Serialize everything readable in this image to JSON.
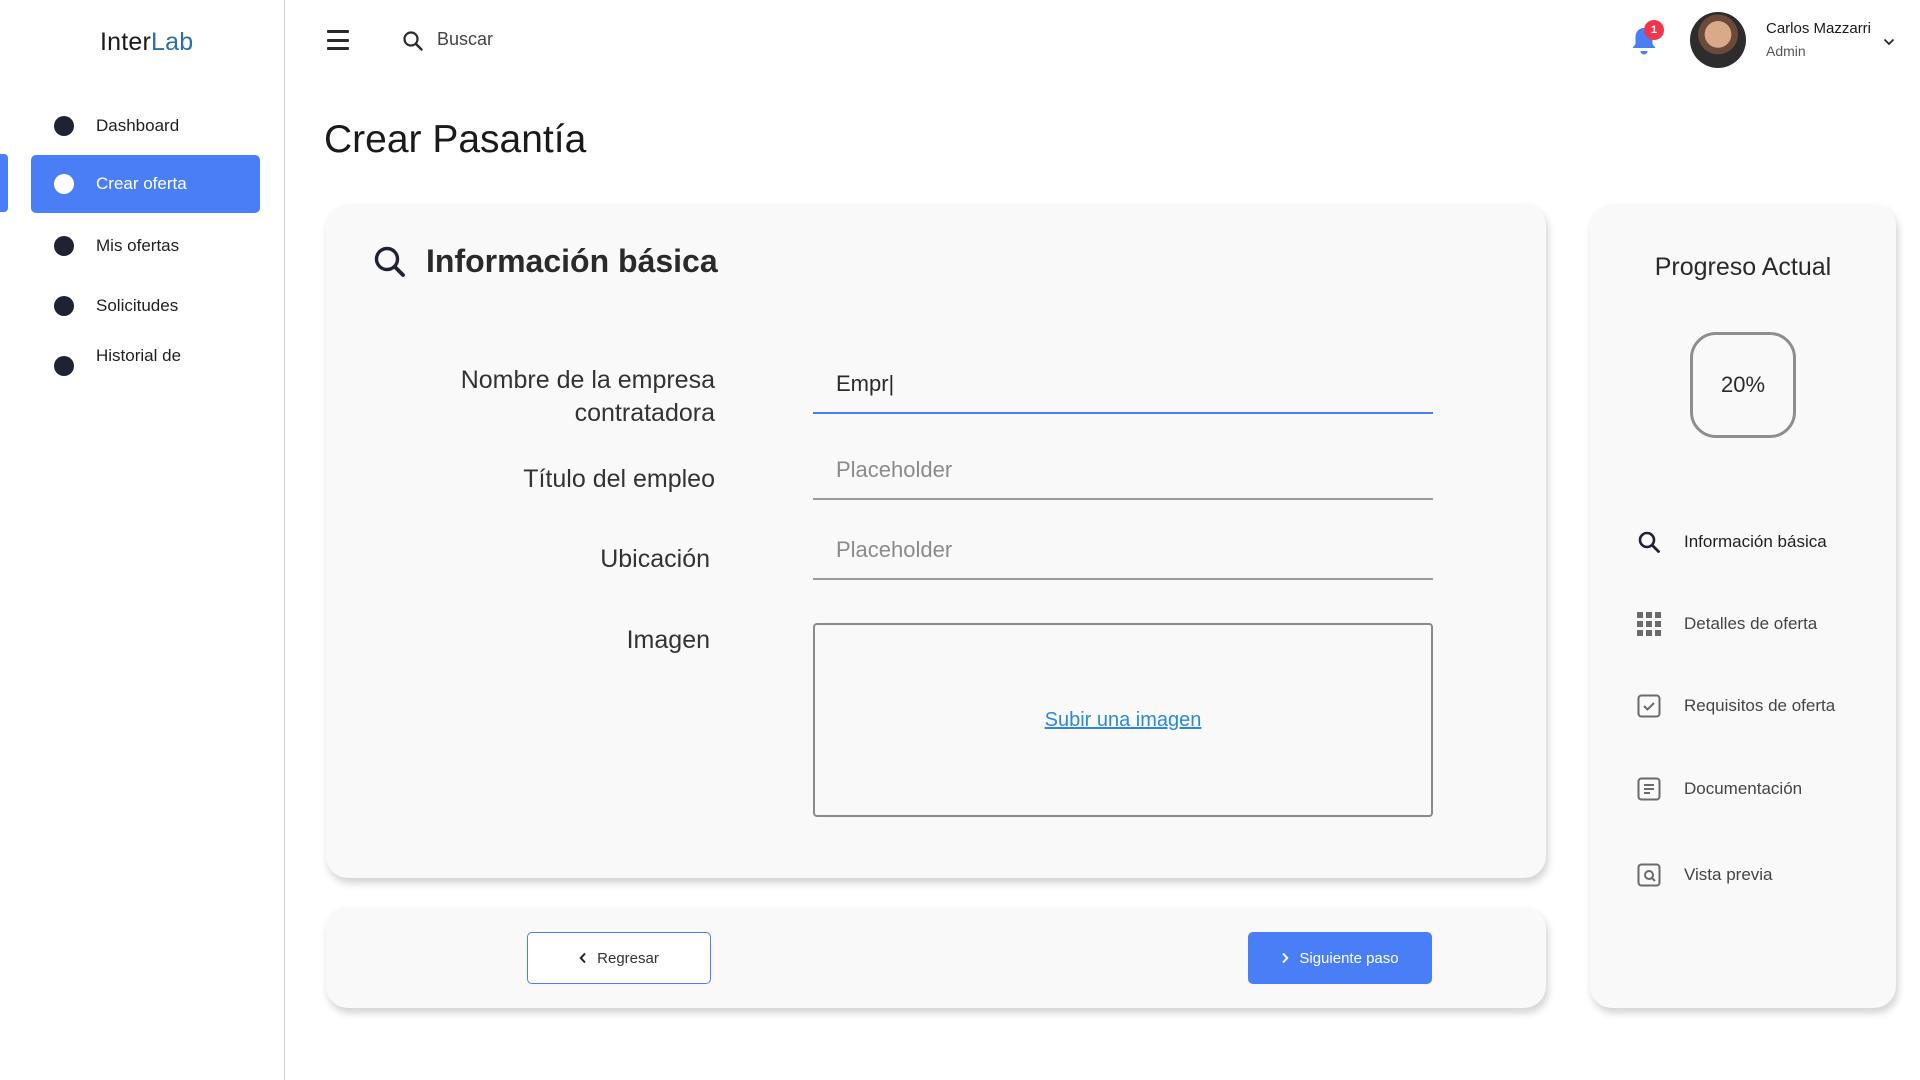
{
  "brand": {
    "part1": "Inter",
    "part2": "Lab"
  },
  "sidebar": {
    "items": [
      {
        "label": "Dashboard",
        "active": false
      },
      {
        "label": "Crear oferta",
        "active": true
      },
      {
        "label": "Mis ofertas",
        "active": false
      },
      {
        "label": "Solicitudes",
        "active": false
      },
      {
        "label": "Historial de",
        "active": false
      }
    ]
  },
  "topbar": {
    "search_label": "Buscar",
    "notifications_count": "1",
    "user_name": "Carlos Mazzarri",
    "user_role": "Admin"
  },
  "page": {
    "title": "Crear Pasantía"
  },
  "form": {
    "section_title": "Información básica",
    "fields": [
      {
        "label_line1": "Nombre de la empresa",
        "label_line2": "contratadora",
        "value": "Empr|",
        "placeholder": ""
      },
      {
        "label": "Título del empleo",
        "value": "",
        "placeholder": "Placeholder"
      },
      {
        "label": "Ubicación",
        "value": "",
        "placeholder": "Placeholder"
      }
    ],
    "image_label": "Imagen",
    "upload_link": "Subir una imagen"
  },
  "actions": {
    "back_label": "Regresar",
    "next_label": "Siguiente paso"
  },
  "progress": {
    "title": "Progreso Actual",
    "percent_label": "20%",
    "percent": 20,
    "steps": [
      {
        "label": "Información básica",
        "icon": "search-icon"
      },
      {
        "label": "Detalles de oferta",
        "icon": "grid-icon"
      },
      {
        "label": "Requisitos de oferta",
        "icon": "checkbox-icon"
      },
      {
        "label": "Documentación",
        "icon": "document-icon"
      },
      {
        "label": "Vista previa",
        "icon": "preview-icon"
      }
    ]
  },
  "colors": {
    "accent": "#4a7ef7",
    "badge": "#f0364a",
    "link": "#2a8ad8",
    "brand_accent": "#2a6fa8"
  }
}
